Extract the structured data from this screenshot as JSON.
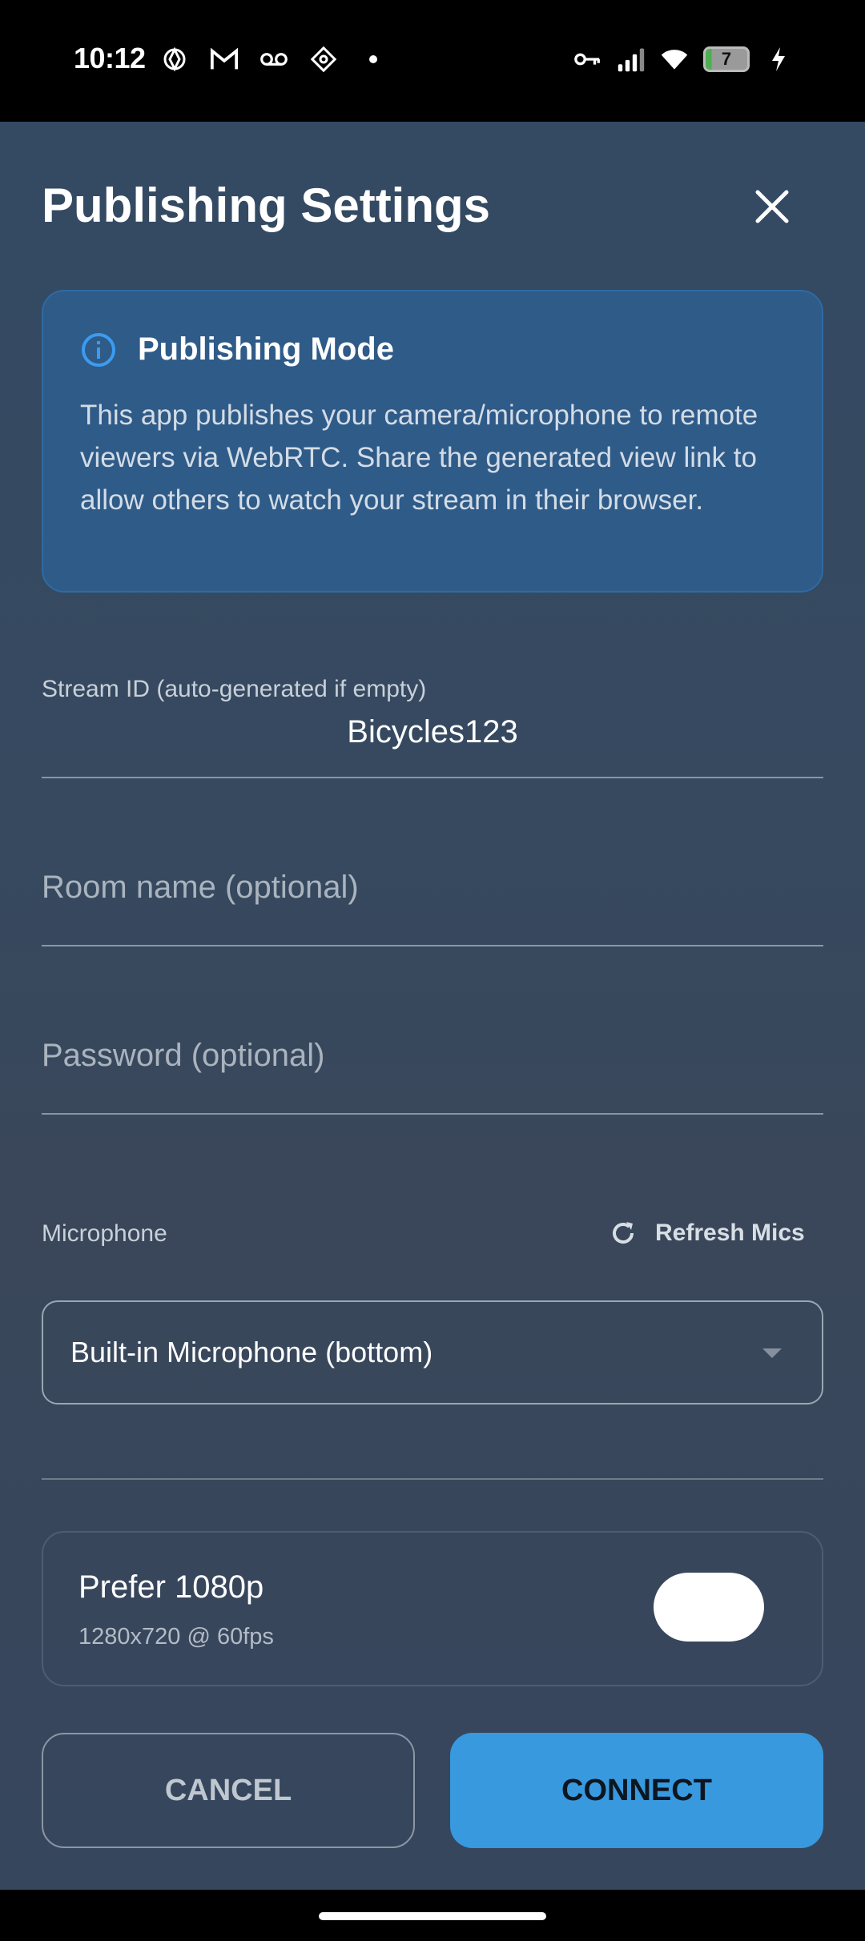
{
  "status_bar": {
    "time": "10:12",
    "left_icons": [
      "openai-icon",
      "gmail-icon",
      "voicemail-icon",
      "app-icon",
      "dot-icon"
    ],
    "right_icons": [
      "vpn-key-icon",
      "signal-icon",
      "wifi-icon"
    ],
    "battery_level": "7"
  },
  "dialog": {
    "title": "Publishing Settings",
    "close_icon": "close-icon"
  },
  "info_card": {
    "title": "Publishing Mode",
    "body": "This app publishes your camera/microphone to remote viewers via WebRTC. Share the generated view link to allow others to watch your stream in their browser."
  },
  "fields": {
    "stream_id_label": "Stream ID (auto-generated if empty)",
    "stream_id_value": "Bicycles123",
    "room_placeholder": "Room name (optional)",
    "password_placeholder": "Password (optional)"
  },
  "microphone": {
    "label": "Microphone",
    "refresh_label": "Refresh Mics",
    "selected": "Built-in Microphone (bottom)"
  },
  "preference": {
    "title": "Prefer 1080p",
    "subtitle": "1280x720 @ 60fps",
    "toggle_on": true
  },
  "actions": {
    "cancel_label": "CANCEL",
    "connect_label": "CONNECT"
  },
  "colors": {
    "accent": "#3899de",
    "info_card": "#2f5b88"
  }
}
